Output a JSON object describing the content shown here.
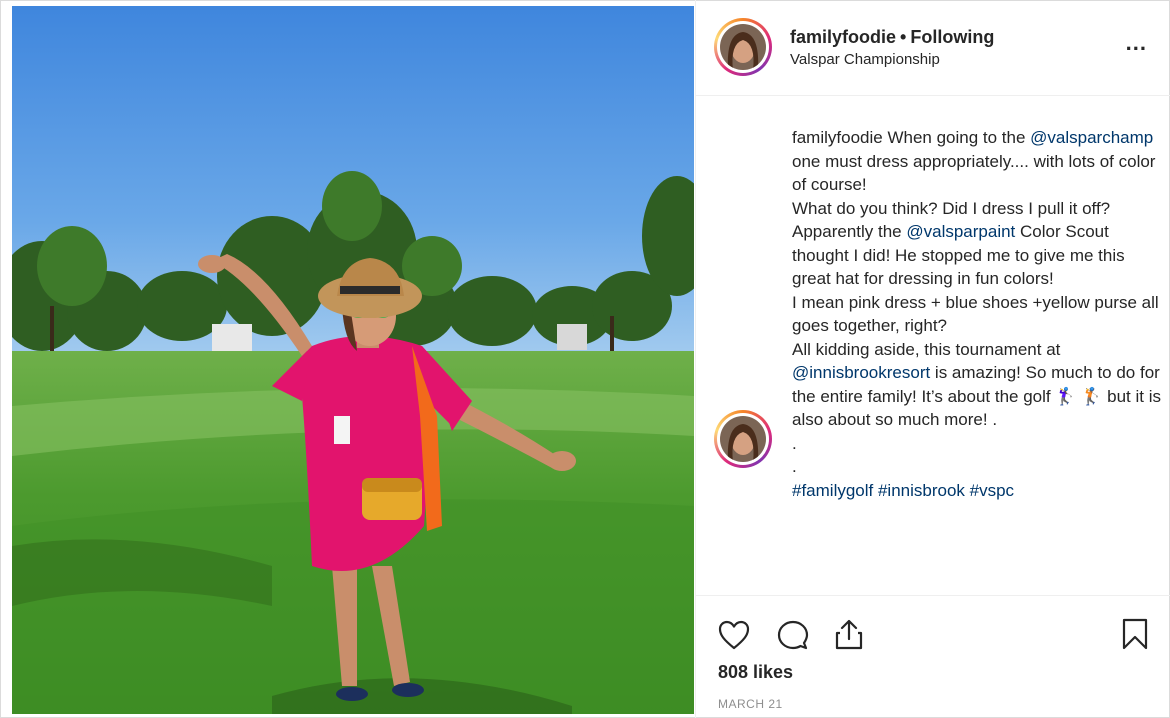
{
  "post": {
    "username": "familyfoodie",
    "separator": "•",
    "follow_status": "Following",
    "location": "Valspar Championship",
    "more_label": "...",
    "caption": {
      "username": "familyfoodie",
      "p1_pre": " When going to the ",
      "mention1": "@valsparchamp",
      "p1_post": " one must dress appropriately.... with lots of color of course!",
      "p2": "What do you think? Did I dress I pull it off?",
      "p3_pre": "Apparently the ",
      "mention2": "@valsparpaint",
      "p3_post": " Color Scout thought I did! He stopped me to give me this great hat for dressing in fun colors!",
      "p4": "I mean pink dress + blue shoes +yellow purse all goes together, right?",
      "p5_pre": "All kidding aside, this tournament at ",
      "mention3": "@innisbrookresort",
      "p5_post": " is amazing! So much to do for the entire family! It’s about the golf 🏌️‍♀️ 🏌️ but it is also about so much more! .",
      "dot1": ".",
      "dot2": ".",
      "hashtags": "#familygolf #innisbrook #vspc"
    },
    "likes": "808 likes",
    "date": "MARCH 21"
  },
  "icons": {
    "like": "heart-icon",
    "comment": "comment-bubble-icon",
    "share": "share-icon",
    "save": "bookmark-icon",
    "more": "more-dots-icon"
  },
  "colors": {
    "link": "#00376b",
    "text": "#262626",
    "muted": "#8e8e8e",
    "border": "#efefef"
  }
}
